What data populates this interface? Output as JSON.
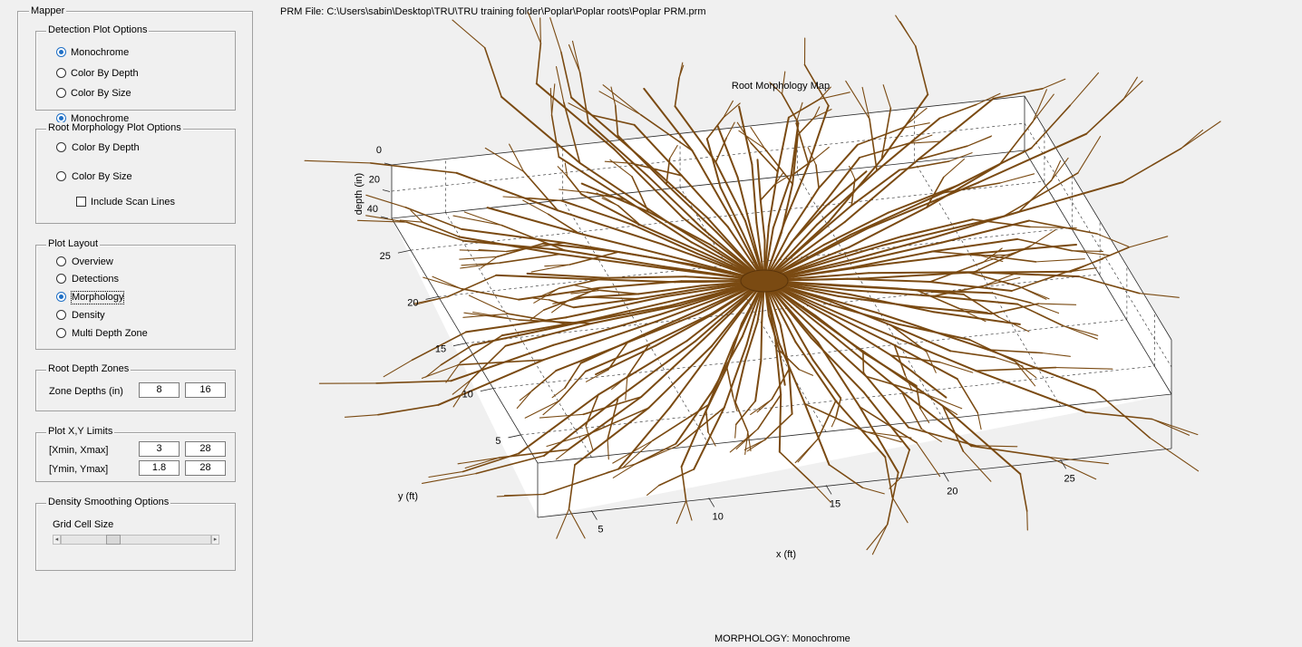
{
  "panel": {
    "title": "Mapper",
    "detection": {
      "title": "Detection Plot Options",
      "options": [
        "Monochrome",
        "Color By Depth",
        "Color By Size"
      ],
      "selected": 0
    },
    "overlap_label": "Monochrome",
    "morphology": {
      "title": "Root Morphology Plot Options",
      "options": [
        "Color By Depth",
        "Color By Size"
      ],
      "scan_lines_label": "Include Scan Lines"
    },
    "layout": {
      "title": "Plot Layout",
      "options": [
        "Overview",
        "Detections",
        "Morphology",
        "Density",
        "Multi Depth Zone"
      ],
      "selected": 2
    },
    "zones": {
      "title": "Root Depth Zones",
      "label": "Zone Depths (in)",
      "values": [
        "8",
        "16"
      ]
    },
    "limits": {
      "title": "Plot X,Y Limits",
      "x_label": "[Xmin, Xmax]",
      "x_values": [
        "3",
        "28"
      ],
      "y_label": "[Ymin, Ymax]",
      "y_values": [
        "1.8",
        "28"
      ]
    },
    "density": {
      "title": "Density Smoothing Options",
      "label": "Grid Cell Size",
      "slider_value": 0.33
    }
  },
  "file_path": "PRM File: C:\\Users\\sabin\\Desktop\\TRU\\TRU training folder\\Poplar\\Poplar roots\\Poplar PRM.prm",
  "plot": {
    "title": "Root Morphology Map",
    "xlabel": "x (ft)",
    "ylabel": "y (ft)",
    "zlabel": "depth (in)",
    "x_ticks": [
      "5",
      "10",
      "15",
      "20",
      "25"
    ],
    "y_ticks": [
      "5",
      "10",
      "15",
      "20",
      "25"
    ],
    "z_ticks": [
      "0",
      "20",
      "40"
    ],
    "root_color": "#7a4a12"
  },
  "status": "MORPHOLOGY: Monochrome"
}
